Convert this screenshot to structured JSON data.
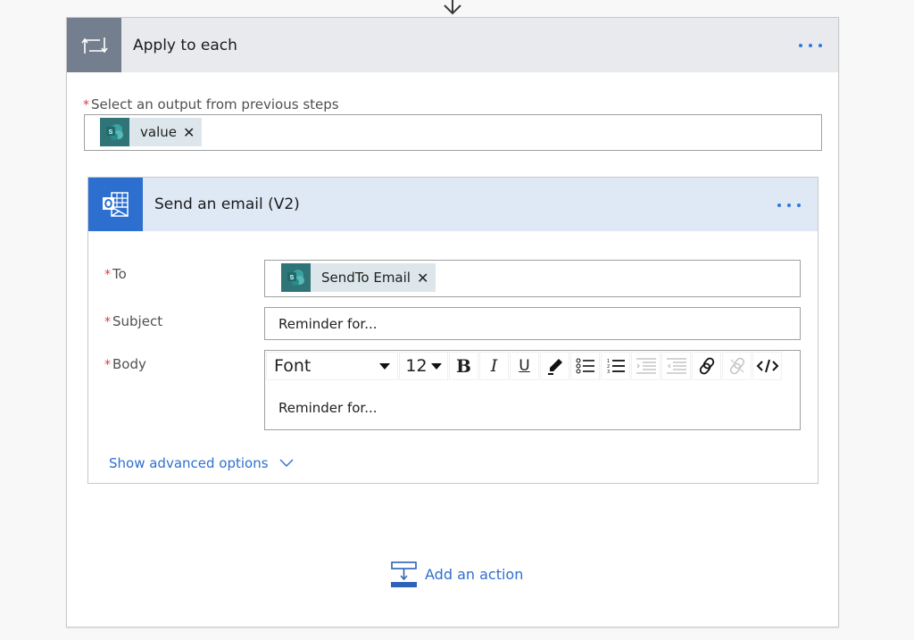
{
  "connector_arrow": {
    "icon": "arrow-down-icon"
  },
  "apply_to_each": {
    "title": "Apply to each",
    "icon": "loop-icon",
    "more_icon": "more-options-icon",
    "output_field": {
      "label": "Select an output from previous steps",
      "required_marker": "*",
      "token": {
        "label": "value",
        "icon": "sharepoint-icon",
        "remove": "✕"
      }
    }
  },
  "send_email": {
    "title": "Send an email (V2)",
    "icon": "outlook-icon",
    "more_icon": "more-options-icon",
    "fields": {
      "to": {
        "label": "To",
        "required_marker": "*",
        "token": {
          "label": "SendTo Email",
          "icon": "sharepoint-icon",
          "remove": "✕"
        }
      },
      "subject": {
        "label": "Subject",
        "required_marker": "*",
        "value": "Reminder for..."
      },
      "body": {
        "label": "Body",
        "required_marker": "*",
        "value": "Reminder for...",
        "toolbar": {
          "font": "Font",
          "size": "12",
          "bold": "B",
          "italic": "I",
          "underline": "U",
          "buttons": [
            "bold",
            "italic",
            "underline",
            "highlight",
            "bulleted-list",
            "numbered-list",
            "increase-indent",
            "decrease-indent",
            "link",
            "unlink",
            "code-view"
          ]
        }
      }
    },
    "advanced_options": "Show advanced options"
  },
  "add_action": {
    "label": "Add an action",
    "icon": "add-action-icon"
  },
  "colors": {
    "accent": "#2f6fcf",
    "outer_header_bg": "#e9eaed",
    "outer_icon_bg": "#737f8e",
    "inner_header_bg": "#dfe8f5",
    "inner_icon_bg": "#2c6fcf",
    "token_bg": "#dde6ea",
    "token_icon_bg": "#2f7577",
    "required": "#e0393e"
  }
}
